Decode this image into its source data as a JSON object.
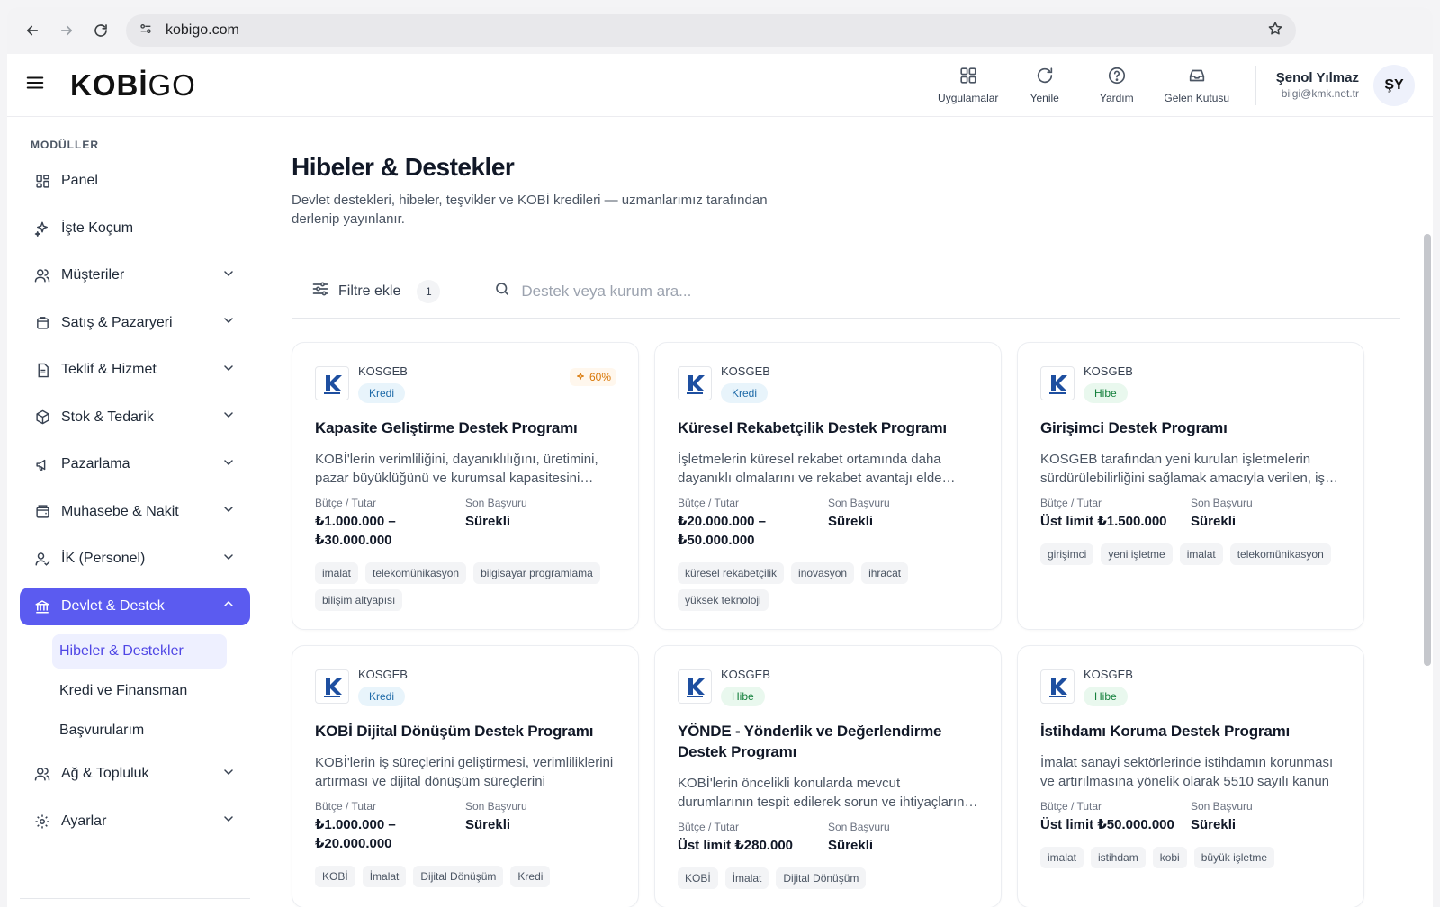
{
  "browser": {
    "url": "kobigo.com"
  },
  "header": {
    "logo_bold": "KOBİ",
    "logo_light": "GO",
    "actions": [
      {
        "label": "Uygulamalar",
        "icon": "grid-icon"
      },
      {
        "label": "Yenile",
        "icon": "refresh-icon"
      },
      {
        "label": "Yardım",
        "icon": "help-icon"
      },
      {
        "label": "Gelen Kutusu",
        "icon": "inbox-icon"
      }
    ],
    "user": {
      "name": "Şenol Yılmaz",
      "email": "bilgi@kmk.net.tr",
      "initials": "ŞY"
    }
  },
  "sidebar": {
    "heading": "MODÜLLER",
    "items": [
      {
        "label": "Panel",
        "icon": "dashboard-icon"
      },
      {
        "label": "İşte Koçum",
        "icon": "sparkle-icon"
      },
      {
        "label": "Müşteriler",
        "icon": "users-icon"
      },
      {
        "label": "Satış & Pazaryeri",
        "icon": "shopping-bag-icon"
      },
      {
        "label": "Teklif & Hizmet",
        "icon": "document-icon"
      },
      {
        "label": "Stok & Tedarik",
        "icon": "box-icon"
      },
      {
        "label": "Pazarlama",
        "icon": "megaphone-icon"
      },
      {
        "label": "Muhasebe & Nakit",
        "icon": "wallet-icon"
      },
      {
        "label": "İK (Personel)",
        "icon": "person-icon"
      },
      {
        "label": "Devlet & Destek",
        "icon": "government-icon"
      },
      {
        "label": "Ağ & Topluluk",
        "icon": "network-icon"
      },
      {
        "label": "Ayarlar",
        "icon": "gear-icon"
      }
    ],
    "sub_items": [
      "Hibeler & Destekler",
      "Kredi ve Finansman",
      "Başvurularım"
    ]
  },
  "main": {
    "title": "Hibeler & Destekler",
    "subtitle": "Devlet destekleri, hibeler, teşvikler ve KOBİ kredileri — uzmanlarımız tarafından derlenip yayınlanır.",
    "filter_label": "Filtre ekle",
    "filter_count": "1",
    "search_placeholder": "Destek veya kurum ara..."
  },
  "labels": {
    "budget": "Bütçe / Tutar",
    "deadline": "Son Başvuru"
  },
  "cards": [
    {
      "org": "KOSGEB",
      "type": "Kredi",
      "match": "60%",
      "title": "Kapasite Geliştirme Destek Programı",
      "desc": "KOBİ'lerin verimliliğini, dayanıklılığını, üretimini, pazar büyüklüğünü ve kurumsal kapasitesini artırmak",
      "budget": "₺1.000.000 – ₺30.000.000",
      "deadline": "Sürekli",
      "tags": [
        "imalat",
        "telekomünikasyon",
        "bilgisayar programlama",
        "bilişim altyapısı"
      ]
    },
    {
      "org": "KOSGEB",
      "type": "Kredi",
      "match": "",
      "title": "Küresel Rekabetçilik Destek Programı",
      "desc": "İşletmelerin küresel rekabet ortamında daha dayanıklı olmalarını ve rekabet avantajı elde etmelerini",
      "budget": "₺20.000.000 – ₺50.000.000",
      "deadline": "Sürekli",
      "tags": [
        "küresel rekabetçilik",
        "inovasyon",
        "ihracat",
        "yüksek teknoloji"
      ]
    },
    {
      "org": "KOSGEB",
      "type": "Hibe",
      "match": "",
      "title": "Girişimci Destek Programı",
      "desc": "KOSGEB tarafından yeni kurulan işletmelerin sürdürülebilirliğini sağlamak amacıyla verilen, iş planı",
      "budget": "Üst limit ₺1.500.000",
      "deadline": "Sürekli",
      "tags": [
        "girişimci",
        "yeni işletme",
        "imalat",
        "telekomünikasyon"
      ]
    },
    {
      "org": "KOSGEB",
      "type": "Kredi",
      "match": "",
      "title": "KOBİ Dijital Dönüşüm Destek Programı",
      "desc": "KOBİ'lerin iş süreçlerini geliştirmesi, verimliliklerini artırması ve dijital dönüşüm süreçlerini",
      "budget": "₺1.000.000 – ₺20.000.000",
      "deadline": "Sürekli",
      "tags": [
        "KOBİ",
        "İmalat",
        "Dijital Dönüşüm",
        "Kredi"
      ]
    },
    {
      "org": "KOSGEB",
      "type": "Hibe",
      "match": "",
      "title": "YÖNDE - Yönderlik ve Değerlendirme Destek Programı",
      "desc": "KOBİ'lerin öncelikli konularda mevcut durumlarının tespit edilerek sorun ve ihtiyaçlarının belirlenmesi",
      "budget": "Üst limit ₺280.000",
      "deadline": "Sürekli",
      "tags": [
        "KOBİ",
        "İmalat",
        "Dijital Dönüşüm"
      ]
    },
    {
      "org": "KOSGEB",
      "type": "Hibe",
      "match": "",
      "title": "İstihdamı Koruma Destek Programı",
      "desc": "İmalat sanayi sektörlerinde istihdamın korunması ve artırılmasına yönelik olarak 5510 sayılı kanun",
      "budget": "Üst limit ₺50.000.000",
      "deadline": "Sürekli",
      "tags": [
        "imalat",
        "istihdam",
        "kobi",
        "büyük işletme"
      ]
    }
  ],
  "colors": {
    "accent": "#5b5bf0",
    "kredi": "#1e6aa8",
    "hibe": "#15803d"
  }
}
